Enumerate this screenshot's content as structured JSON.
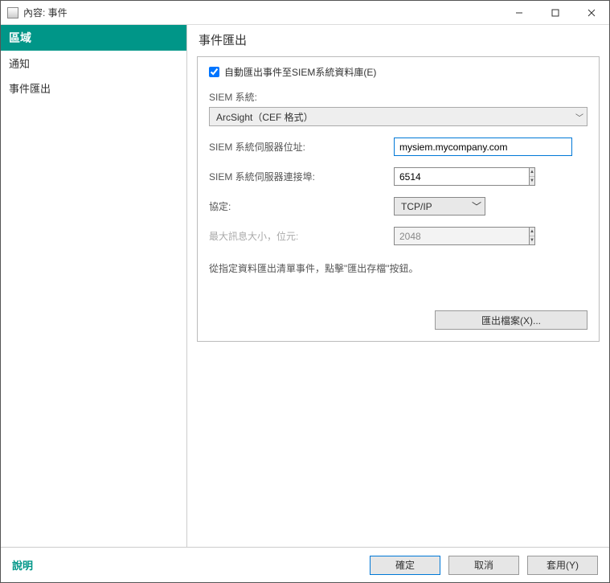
{
  "titlebar": {
    "title": "內容: 事件"
  },
  "sidebar": {
    "header": "區域",
    "items": [
      "通知",
      "事件匯出"
    ]
  },
  "main": {
    "title": "事件匯出",
    "checkbox_label": "自動匯出事件至SIEM系統資料庫(E)",
    "siem_system_label": "SIEM 系統:",
    "siem_system_value": "ArcSight（CEF 格式）",
    "server_addr_label": "SIEM 系統伺服器位址:",
    "server_addr_value": "mysiem.mycompany.com",
    "server_port_label": "SIEM 系統伺服器連接埠:",
    "server_port_value": "6514",
    "protocol_label": "協定:",
    "protocol_value": "TCP/IP",
    "max_msg_label": "最大訊息大小，位元:",
    "max_msg_value": "2048",
    "instruction": "從指定資料匯出清單事件，點擊\"匯出存檔\"按鈕。",
    "export_button": "匯出檔案(X)..."
  },
  "footer": {
    "help": "說明",
    "ok": "確定",
    "cancel": "取消",
    "apply": "套用(Y)"
  }
}
